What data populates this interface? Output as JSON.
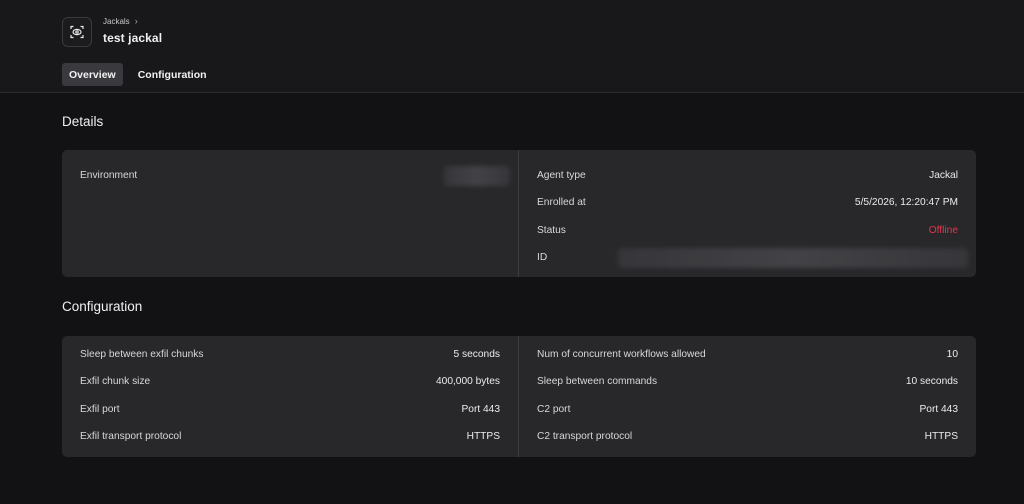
{
  "header": {
    "breadcrumb": "Jackals",
    "breadcrumb_chevron": "›",
    "title": "test jackal",
    "icon": "jackal-agent-icon"
  },
  "tabs": [
    {
      "label": "Overview",
      "active": true
    },
    {
      "label": "Configuration",
      "active": false
    }
  ],
  "details": {
    "title": "Details",
    "left": [
      {
        "label": "Environment",
        "value": ""
      }
    ],
    "right": [
      {
        "label": "Agent type",
        "value": "Jackal"
      },
      {
        "label": "Enrolled at",
        "value": "5/5/2026, 12:20:47 PM"
      },
      {
        "label": "Status",
        "value": "Offline"
      },
      {
        "label": "ID",
        "value": ""
      }
    ]
  },
  "configuration": {
    "title": "Configuration",
    "left": [
      {
        "label": "Sleep between exfil chunks",
        "value": "5 seconds"
      },
      {
        "label": "Exfil chunk size",
        "value": "400,000 bytes"
      },
      {
        "label": "Exfil port",
        "value": "Port 443"
      },
      {
        "label": "Exfil transport protocol",
        "value": "HTTPS"
      }
    ],
    "right": [
      {
        "label": "Num of concurrent workflows allowed",
        "value": "10"
      },
      {
        "label": "Sleep between commands",
        "value": "10 seconds"
      },
      {
        "label": "C2 port",
        "value": "Port 443"
      },
      {
        "label": "C2 transport protocol",
        "value": "HTTPS"
      }
    ]
  },
  "colors": {
    "background": "#121214",
    "card": "#28282b",
    "offline": "#e8344a"
  }
}
